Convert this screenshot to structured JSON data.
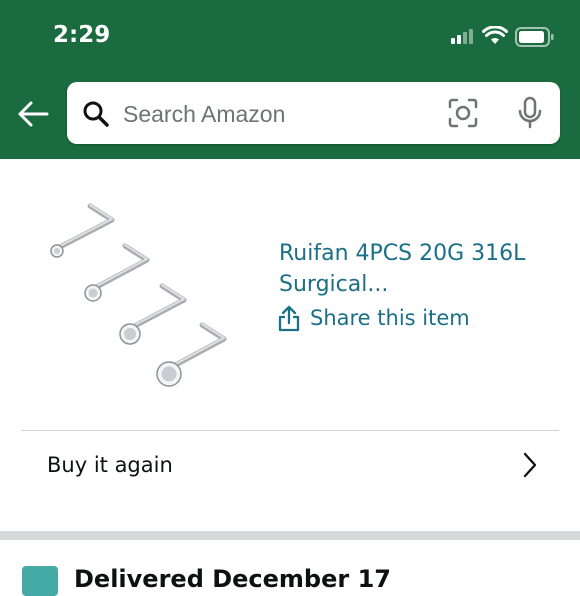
{
  "status_bar": {
    "time": "2:29",
    "icons": [
      "cellular-signal-icon",
      "wifi-icon",
      "battery-icon"
    ]
  },
  "header": {
    "background_color": "#1a6b3f",
    "search": {
      "placeholder": "Search Amazon",
      "icons": [
        "back-arrow-icon",
        "search-icon",
        "camera-scan-icon",
        "microphone-icon"
      ]
    }
  },
  "product": {
    "title": "Ruifan 4PCS 20G 316L Surgical...",
    "share_label": "Share this item",
    "link_color": "#1b6f87"
  },
  "buy_again": {
    "label": "Buy it again"
  },
  "delivery": {
    "status": "Delivered December 17",
    "badge_color": "#45a9a5"
  }
}
